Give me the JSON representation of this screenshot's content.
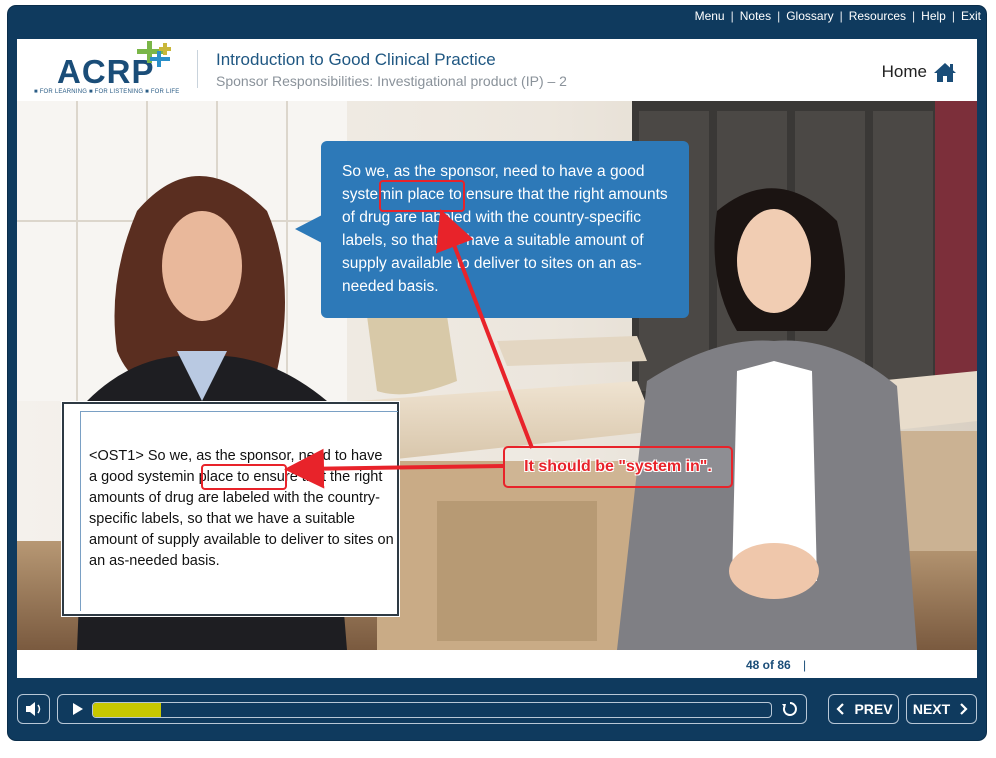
{
  "top_menu": {
    "menu": "Menu",
    "notes": "Notes",
    "glossary": "Glossary",
    "resources": "Resources",
    "help": "Help",
    "exit": "Exit",
    "separator": "|"
  },
  "logo": {
    "text": "ACRP",
    "tagline": "■ FOR LEARNING ■ FOR LISTENING ■ FOR LIFE"
  },
  "course": {
    "title": "Introduction to Good Clinical Practice",
    "subtitle": "Sponsor Responsibilities: Investigational product (IP) – 2"
  },
  "home": {
    "label": "Home",
    "icon": "home-icon"
  },
  "speech_bubble": {
    "text": "So we, as the sponsor, need to have a good systemin place to ensure that the right amounts of drug are labeled with the country-specific labels, so that we have a suitable amount of supply available to deliver to sites on an as-needed basis."
  },
  "onscreen_text_box": {
    "text": "<OST1> So we, as the sponsor, need to have a good systemin place to ensure that the right amounts of drug are labeled with the country-specific labels, so that we have a suitable amount of supply available to deliver to sites on an as-needed basis."
  },
  "annotation": {
    "callout_text": "It should be \"system in\".",
    "color": "#e8232a"
  },
  "pagination": {
    "label": "48 of 86",
    "separator": "|"
  },
  "player": {
    "audio_icon": "speaker-icon",
    "play_icon": "play-icon",
    "replay_icon": "replay-icon",
    "progress": 0.1
  },
  "nav": {
    "prev_label": "PREV",
    "next_label": "NEXT"
  },
  "colors": {
    "frame": "#0f3a5e",
    "bubble": "#2d79b8",
    "progress": "#c8c800"
  }
}
